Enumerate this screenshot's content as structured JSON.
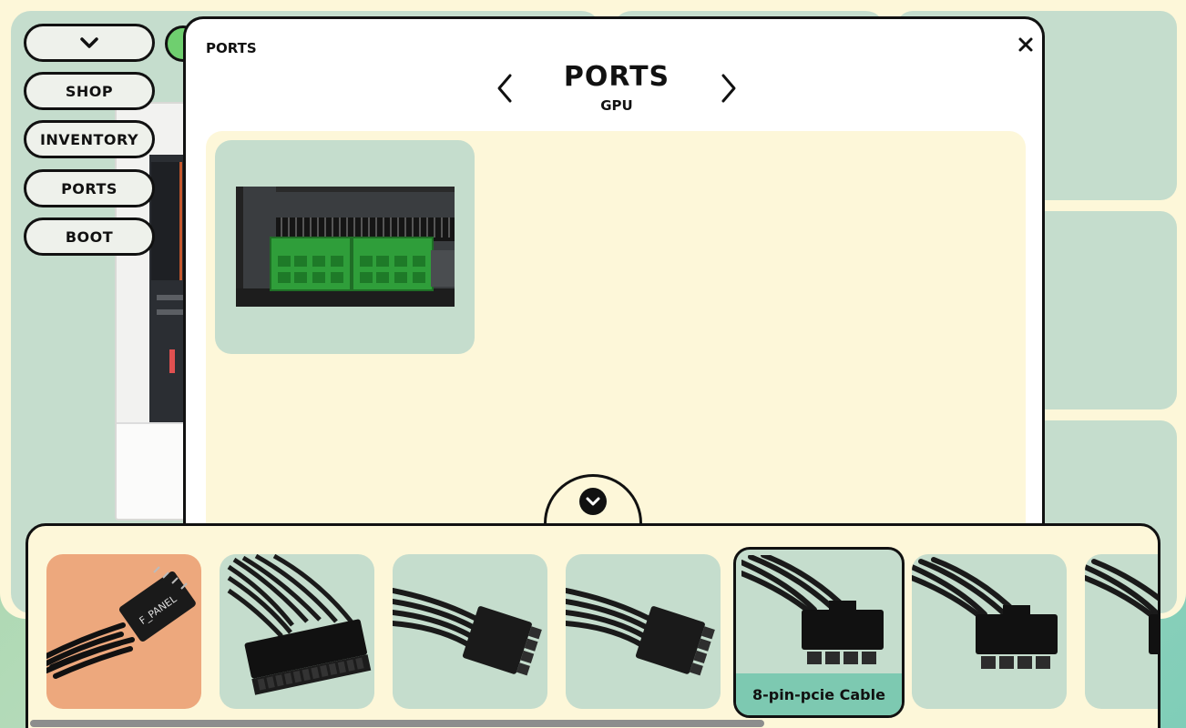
{
  "menu": {
    "toggle_icon": "chevron-down-icon",
    "items": [
      {
        "label": "SHOP"
      },
      {
        "label": "INVENTORY"
      },
      {
        "label": "PORTS"
      },
      {
        "label": "BOOT"
      }
    ]
  },
  "modal": {
    "corner_title": "PORTS",
    "title": "PORTS",
    "subtitle": "GPU",
    "close_label": "×",
    "prev_icon": "chevron-left-icon",
    "next_icon": "chevron-right-icon",
    "port_image": "gpu-8-pin-power-port"
  },
  "tray": {
    "toggle_icon": "chevron-down-icon",
    "items": [
      {
        "image": "f-panel-cable",
        "label": ""
      },
      {
        "image": "24-pin-atx-cable",
        "label": ""
      },
      {
        "image": "8-pin-cpu-cable",
        "label": ""
      },
      {
        "image": "8-pin-cpu-cable",
        "label": ""
      },
      {
        "image": "8-pin-pcie-cable",
        "label": "8-pin-pcie Cable"
      },
      {
        "image": "8-pin-pcie-cable",
        "label": ""
      },
      {
        "image": "8-pin-pcie-cable",
        "label": ""
      }
    ],
    "selected_index": 4
  },
  "colors": {
    "background_cream": "#fdf7d9",
    "panel_green": "#c5ddcd",
    "selected_label": "#7dc9b1",
    "orange_item": "#eda87d",
    "port_green": "#2f9e3a"
  }
}
